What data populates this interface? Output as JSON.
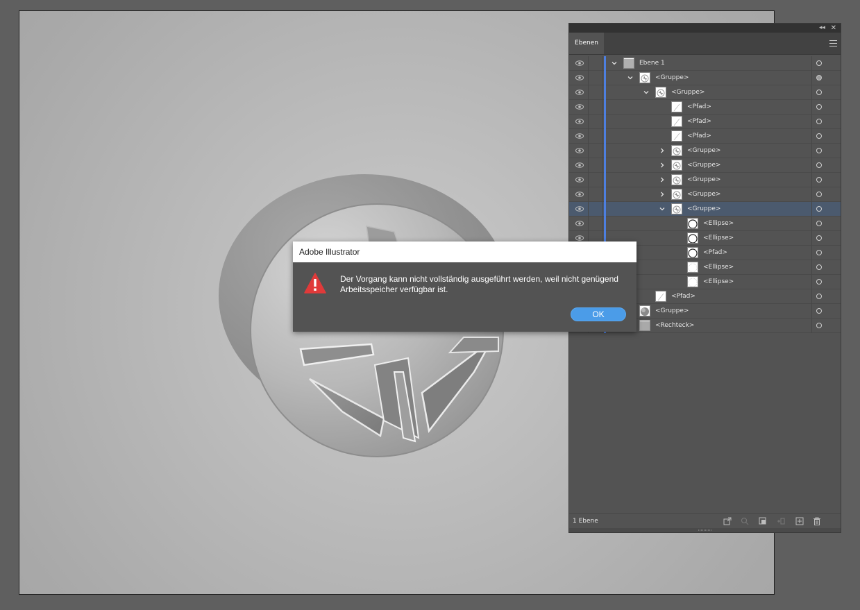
{
  "dialog": {
    "title": "Adobe Illustrator",
    "message_line1": "Der Vorgang kann nicht vollständig ausgeführt werden, weil nicht genügend",
    "message_line2": "Arbeitsspeicher verfügbar ist.",
    "ok_label": "OK",
    "icon": "warning-icon",
    "button_color": "#4b9ce8",
    "icon_color": "#e03a3a"
  },
  "panel": {
    "tab_label": "Ebenen",
    "layer_count": "1 Ebene",
    "layer_color": "#4d7fe0",
    "rows": [
      {
        "name": "Ebene 1",
        "expanded": true,
        "target_filled": false
      },
      {
        "name": "<Gruppe>",
        "expanded": true,
        "target_filled": true
      },
      {
        "name": "<Gruppe>",
        "expanded": true,
        "target_filled": false
      },
      {
        "name": "<Pfad>",
        "target_filled": false
      },
      {
        "name": "<Pfad>",
        "target_filled": false
      },
      {
        "name": "<Pfad>",
        "target_filled": false
      },
      {
        "name": "<Gruppe>",
        "expanded": false,
        "target_filled": false
      },
      {
        "name": "<Gruppe>",
        "expanded": false,
        "target_filled": false
      },
      {
        "name": "<Gruppe>",
        "expanded": false,
        "target_filled": false
      },
      {
        "name": "<Gruppe>",
        "expanded": false,
        "target_filled": false
      },
      {
        "name": "<Gruppe>",
        "expanded": true,
        "selected": true,
        "target_filled": false
      },
      {
        "name": "<Ellipse>",
        "target_filled": false
      },
      {
        "name": "<Ellipse>",
        "target_filled": false
      },
      {
        "name": "<Pfad>",
        "target_filled": false
      },
      {
        "name": "<Ellipse>",
        "target_filled": false
      },
      {
        "name": "<Ellipse>",
        "target_filled": false
      },
      {
        "name": "<Pfad>",
        "target_filled": false
      },
      {
        "name": "<Gruppe>",
        "target_filled": false
      },
      {
        "name": "<Rechteck>",
        "target_filled": false
      }
    ],
    "bottom_icons": [
      "export-icon",
      "search-icon",
      "clipping-mask-icon",
      "new-sublayer-icon",
      "new-layer-icon",
      "delete-icon"
    ]
  }
}
